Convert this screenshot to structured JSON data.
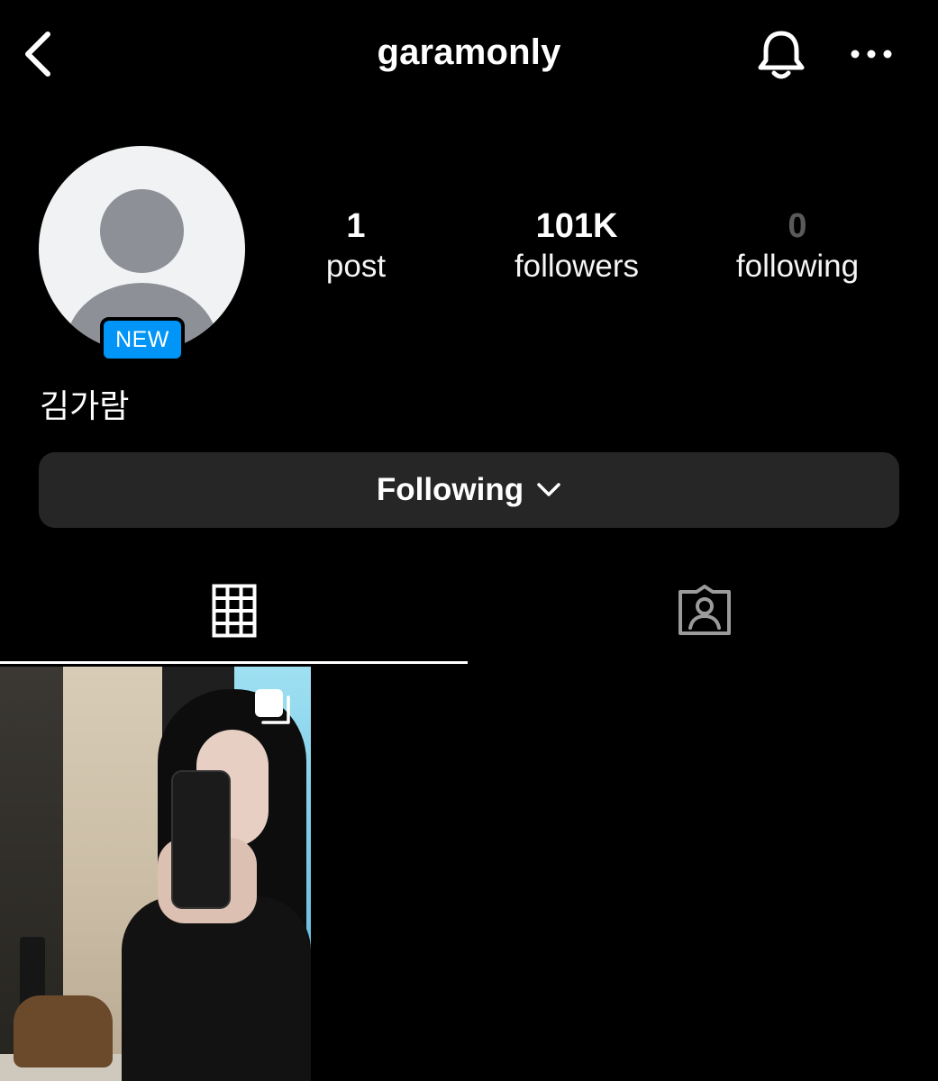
{
  "header": {
    "username": "garamonly",
    "icons": {
      "back": "chevron-left-icon",
      "bell": "bell-icon",
      "more": "more-horizontal-icon"
    }
  },
  "profile": {
    "avatar_badge": "NEW",
    "display_name": "김가람",
    "stats": {
      "posts": {
        "count": "1",
        "label": "post"
      },
      "followers": {
        "count": "101K",
        "label": "followers"
      },
      "following": {
        "count": "0",
        "label": "following"
      }
    }
  },
  "actions": {
    "following_label": "Following"
  },
  "tabs": [
    {
      "name": "posts-grid",
      "icon": "grid-icon",
      "active": true
    },
    {
      "name": "tagged",
      "icon": "tagged-user-icon",
      "active": false
    }
  ],
  "colors": {
    "background": "#000000",
    "button_bg": "#262626",
    "badge_blue": "#0095f6",
    "avatar_bg": "#f1f2f4",
    "avatar_silhouette": "#8e9098"
  },
  "posts": [
    {
      "type": "carousel",
      "icon": "multiple-photos-icon"
    }
  ]
}
